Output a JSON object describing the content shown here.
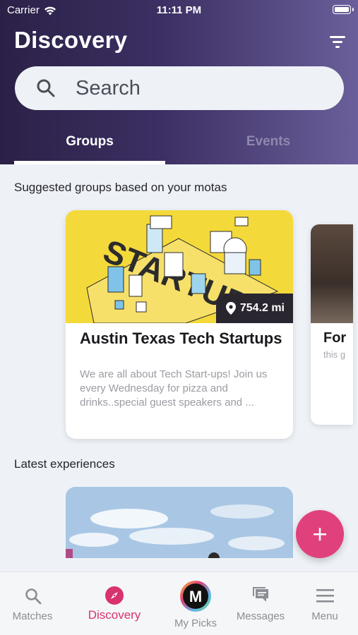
{
  "status_bar": {
    "carrier": "Carrier",
    "time": "11:11 PM"
  },
  "header": {
    "title": "Discovery"
  },
  "search": {
    "placeholder": "Search"
  },
  "tabs": [
    {
      "label": "Groups",
      "active": true
    },
    {
      "label": "Events",
      "active": false
    }
  ],
  "sections": {
    "suggested": "Suggested groups based on your motas",
    "latest": "Latest experiences"
  },
  "cards": [
    {
      "title": "Austin Texas Tech Startups",
      "description": "We are all about Tech Start-ups! Join us every Wednesday for pizza and drinks..special guest speakers and ...",
      "distance": "754.2 mi",
      "image_text": "STARTUP"
    },
    {
      "title": "For",
      "description": "this g"
    }
  ],
  "fab": {
    "label": "+"
  },
  "bottom_nav": [
    {
      "label": "Matches",
      "icon": "search-icon",
      "active": false
    },
    {
      "label": "Discovery",
      "icon": "compass-icon",
      "active": true
    },
    {
      "label": "My Picks",
      "icon": "mypicks-logo-icon",
      "active": false,
      "logo_letter": "M"
    },
    {
      "label": "Messages",
      "icon": "chat-icon",
      "active": false
    },
    {
      "label": "Menu",
      "icon": "menu-icon",
      "active": false
    }
  ],
  "colors": {
    "accent": "#e0417c",
    "header_gradient_start": "#2b2147",
    "header_gradient_end": "#6a5f9a",
    "distance_badge": "#2a2630",
    "card_image_bg": "#f4d93a"
  }
}
